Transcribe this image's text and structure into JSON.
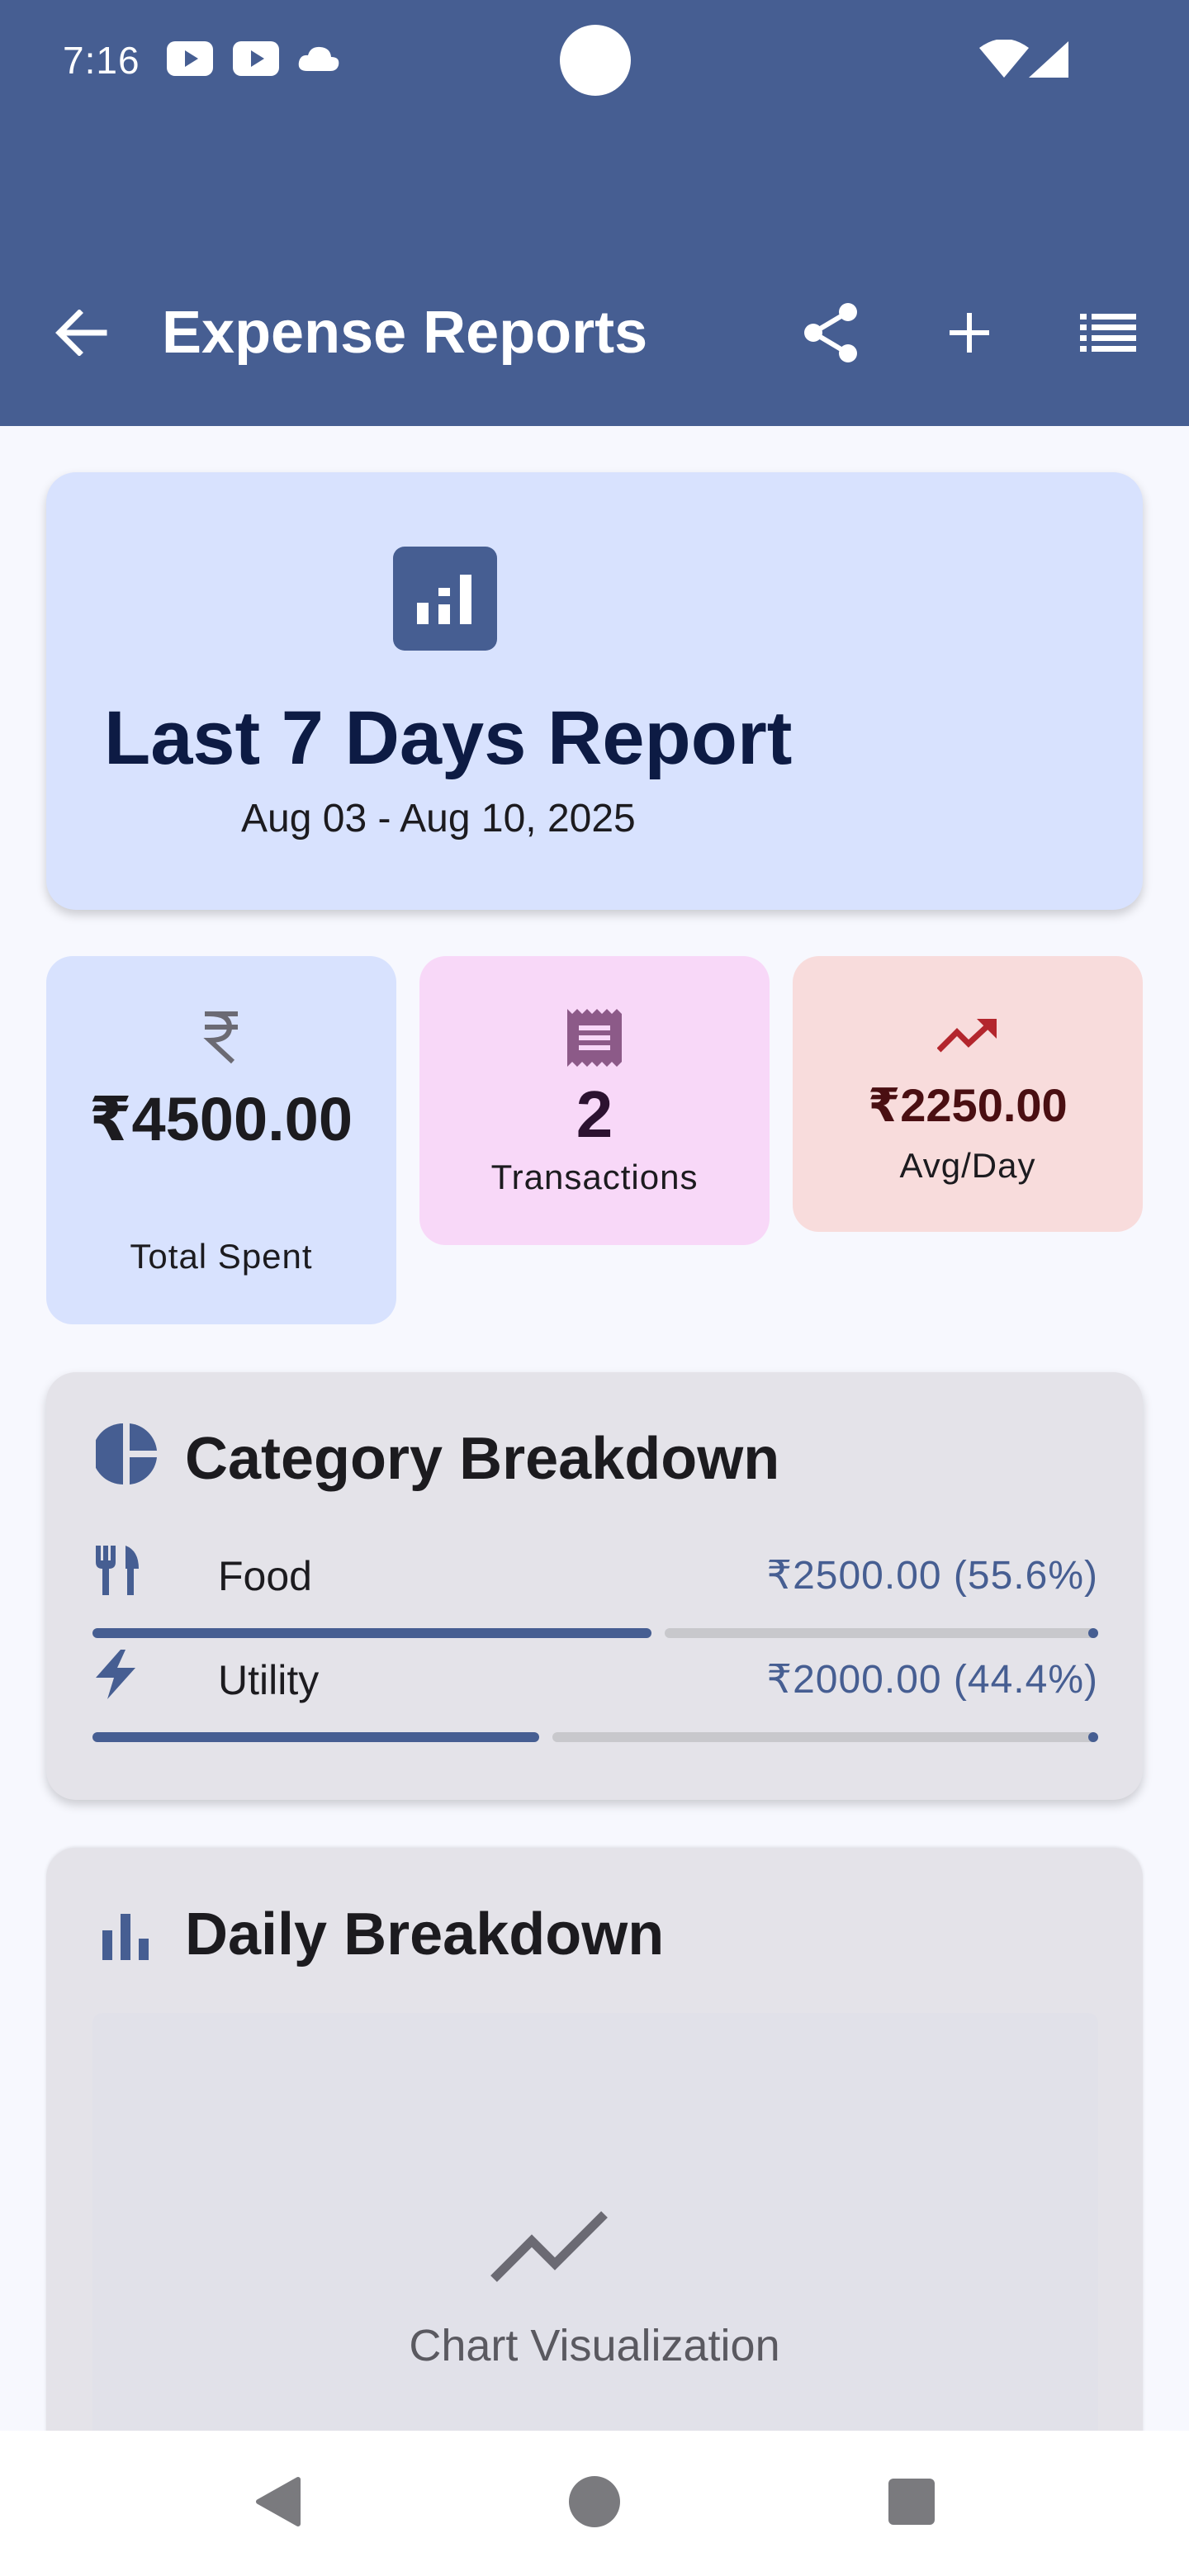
{
  "status_bar": {
    "time": "7:16",
    "icons": [
      "youtube-icon",
      "youtube-icon",
      "cloud-icon",
      "wifi-icon",
      "signal-icon"
    ]
  },
  "toolbar": {
    "title": "Expense Reports",
    "back_icon": "arrow-left-icon",
    "actions": [
      "share-icon",
      "add-icon",
      "list-icon"
    ]
  },
  "hero": {
    "icon": "bar-chart-icon",
    "title": "Last 7 Days Report",
    "date_range": "Aug 03 - Aug 10, 2025"
  },
  "stats": {
    "total": {
      "icon": "rupee-icon",
      "value": "₹4500.00",
      "label": "Total Spent"
    },
    "transactions": {
      "icon": "receipt-icon",
      "value": "2",
      "label": "Transactions"
    },
    "avg": {
      "icon": "trending-up-icon",
      "value": "₹2250.00",
      "label": "Avg/Day"
    }
  },
  "category_breakdown": {
    "title": "Category Breakdown",
    "icon": "pie-chart-icon",
    "items": [
      {
        "name": "Food",
        "icon": "restaurant-icon",
        "amount": "₹2500.00 (55.6%)",
        "fraction": 0.556
      },
      {
        "name": "Utility",
        "icon": "bolt-icon",
        "amount": "₹2000.00 (44.4%)",
        "fraction": 0.444
      }
    ]
  },
  "daily_breakdown": {
    "title": "Daily Breakdown",
    "icon": "bar-chart-icon",
    "placeholder_icon": "line-chart-icon",
    "placeholder_label": "Chart Visualization"
  },
  "nav": {
    "buttons": [
      "back-triangle-icon",
      "home-circle-icon",
      "recents-square-icon"
    ]
  },
  "colors": {
    "primary": "#465e92",
    "hero_bg": "#d8e2fe",
    "tx_bg": "#f8d8f8",
    "avg_bg": "#f8dcdc",
    "avg_icon": "#b3262d",
    "section_bg": "#e4e3e9"
  }
}
